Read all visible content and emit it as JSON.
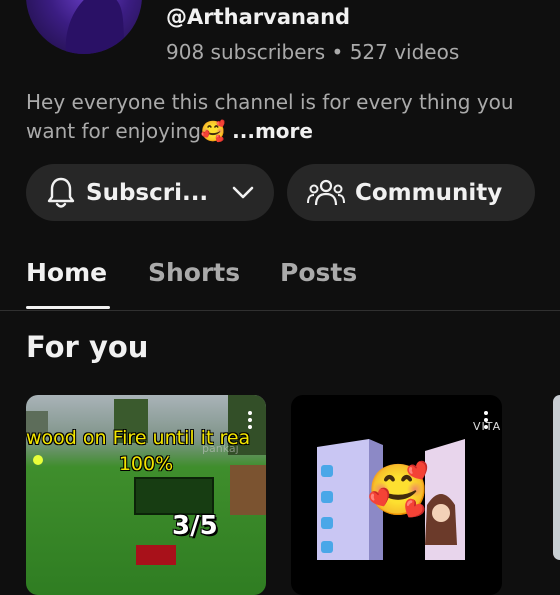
{
  "channel": {
    "handle": "@Artharvanand",
    "subscribers": "908 subscribers",
    "separator": "•",
    "videos": "527 videos",
    "description": "Hey everyone this channel is for every thing you want for enjoying🥰",
    "more_label": "...more"
  },
  "actions": {
    "subscribe_label": "Subscri...",
    "community_label": "Community"
  },
  "tabs": [
    {
      "label": "Home",
      "active": true
    },
    {
      "label": "Shorts",
      "active": false
    },
    {
      "label": "Posts",
      "active": false
    }
  ],
  "section": {
    "title": "For you"
  },
  "cards": [
    {
      "caption_line1": "wood on Fire until it rea",
      "caption_line2": "100%",
      "watermark": "pankaj",
      "counter": "3/5"
    },
    {
      "watermark": "VITA",
      "emoji": "🥰"
    }
  ],
  "colors": {
    "background": "#0f0f0f",
    "pill": "#272727",
    "secondary_text": "#aaaaaa",
    "caption_yellow": "#f2e600"
  }
}
